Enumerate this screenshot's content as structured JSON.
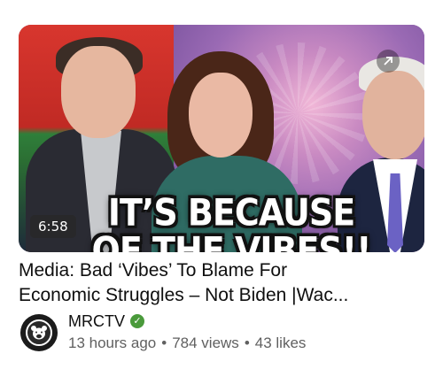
{
  "video": {
    "duration": "6:58",
    "overlay_line1": "IT’S BECAUSE",
    "overlay_line2": "OF THE VIBES!!",
    "title_line1": "Media: Bad ‘Vibes’ To Blame For",
    "title_line2": "Economic Struggles – Not Biden |Wac..."
  },
  "channel": {
    "name": "MRCTV",
    "verified_icon": "verified-check-icon",
    "avatar_icon": "bear-logo-icon"
  },
  "meta": {
    "age": "13 hours ago",
    "views": "784 views",
    "likes": "43 likes",
    "separator": "•"
  },
  "colors": {
    "verified": "#4a9a3b",
    "meta_text": "#606060",
    "title_text": "#0f0f0f"
  }
}
